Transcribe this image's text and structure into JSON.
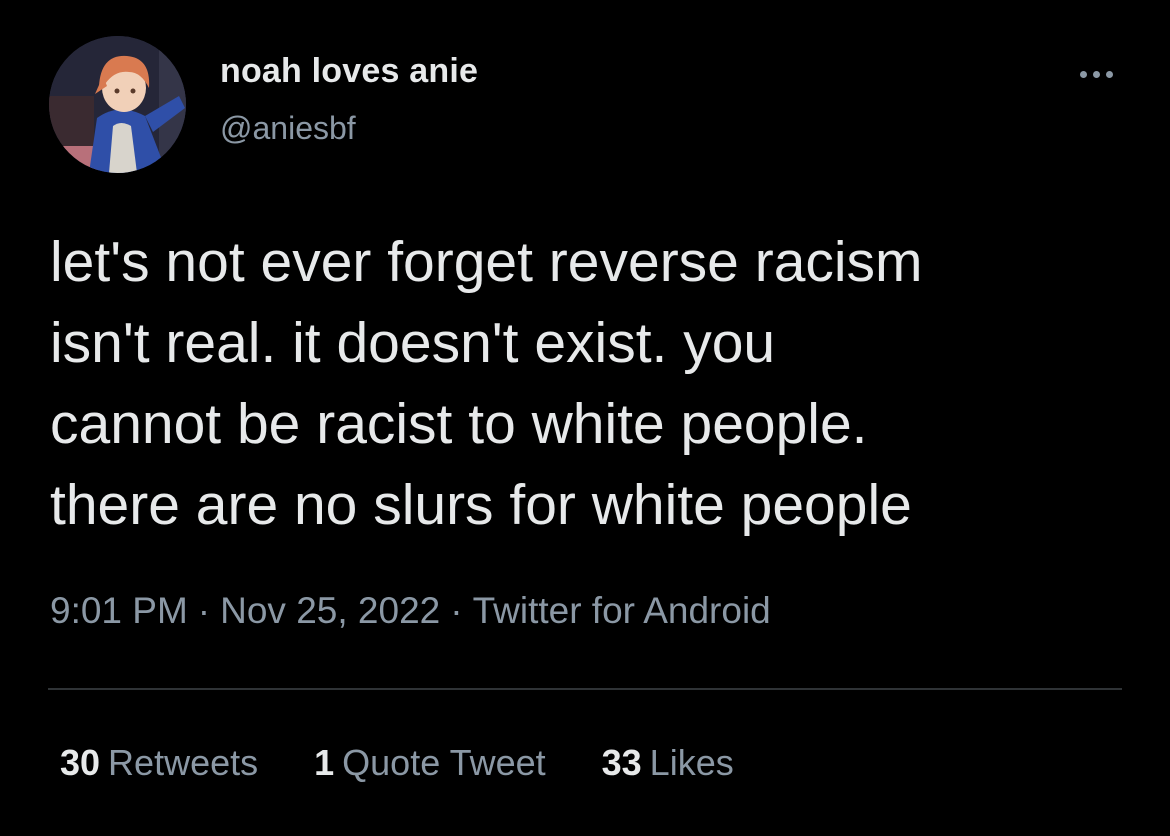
{
  "user": {
    "display_name": "noah loves anie",
    "handle": "@aniesbf"
  },
  "tweet": {
    "text": "let's not ever forget reverse racism\nisn't real. it doesn't exist. you\ncannot be racist to white people.\nthere are no slurs for white people",
    "time": "9:01 PM",
    "date": "Nov 25, 2022",
    "source": "Twitter for Android",
    "separator": "·"
  },
  "stats": {
    "retweets_count": "30",
    "retweets_label": "Retweets",
    "quotes_count": "1",
    "quotes_label": "Quote Tweet",
    "likes_count": "33",
    "likes_label": "Likes"
  },
  "icons": {
    "more": "more-horizontal-icon"
  },
  "colors": {
    "background": "#000000",
    "primary_text": "#e7e9ea",
    "secondary_text": "#8b98a5",
    "divider": "#2f3336"
  }
}
